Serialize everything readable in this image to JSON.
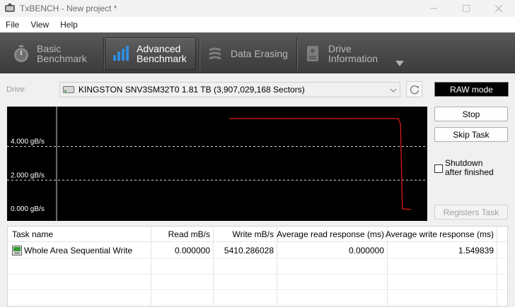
{
  "window": {
    "title": "TxBENCH - New project *"
  },
  "menu": [
    "File",
    "View",
    "Help"
  ],
  "toolbar": {
    "tabs": [
      {
        "line1": "Basic",
        "line2": "Benchmark"
      },
      {
        "line1": "Advanced",
        "line2": "Benchmark"
      },
      {
        "line1": "Data Erasing",
        "line2": ""
      },
      {
        "line1": "Drive",
        "line2": "Information"
      }
    ],
    "active_tab": 1
  },
  "drive": {
    "label": "Drive:",
    "selected": "KINGSTON SNV3SM32T0  1.81 TB (3,907,029,168 Sectors)"
  },
  "buttons": {
    "raw_mode": "RAW mode",
    "stop": "Stop",
    "skip_task": "Skip Task",
    "registers_task": "Registers Task",
    "shutdown_line1": "Shutdown",
    "shutdown_line2": "after finished"
  },
  "chart_data": {
    "type": "line",
    "y_unit": "GB/s",
    "yticks": [
      "4.000 gB/s",
      "2.000 gB/s",
      "0.000 gB/s"
    ],
    "ytick_values": [
      4.0,
      2.0,
      0.0
    ],
    "ylim": [
      0,
      6.2
    ],
    "xlim": [
      0,
      100
    ],
    "grid": true,
    "series": [
      {
        "color": "#d01818",
        "points": [
          [
            47.5,
            5.65
          ],
          [
            55,
            5.66
          ],
          [
            62,
            5.65
          ],
          [
            70,
            5.66
          ],
          [
            78,
            5.65
          ],
          [
            85,
            5.66
          ],
          [
            90,
            5.66
          ],
          [
            94,
            5.65
          ],
          [
            94.6,
            5.3
          ],
          [
            95.1,
            0.3
          ],
          [
            97.5,
            0.25
          ]
        ]
      }
    ]
  },
  "table": {
    "columns": [
      "Task name",
      "Read mB/s",
      "Write mB/s",
      "Average read response (ms)",
      "Average write response (ms)"
    ],
    "rows": [
      {
        "task": "Whole Area Sequential Write",
        "read": "0.000000",
        "write": "5410.286028",
        "avg_read": "0.000000",
        "avg_write": "1.549839"
      }
    ]
  },
  "colors": {
    "graph_bg": "#000000",
    "graph_line": "#d01818",
    "toolbar_bg": "#474747"
  }
}
